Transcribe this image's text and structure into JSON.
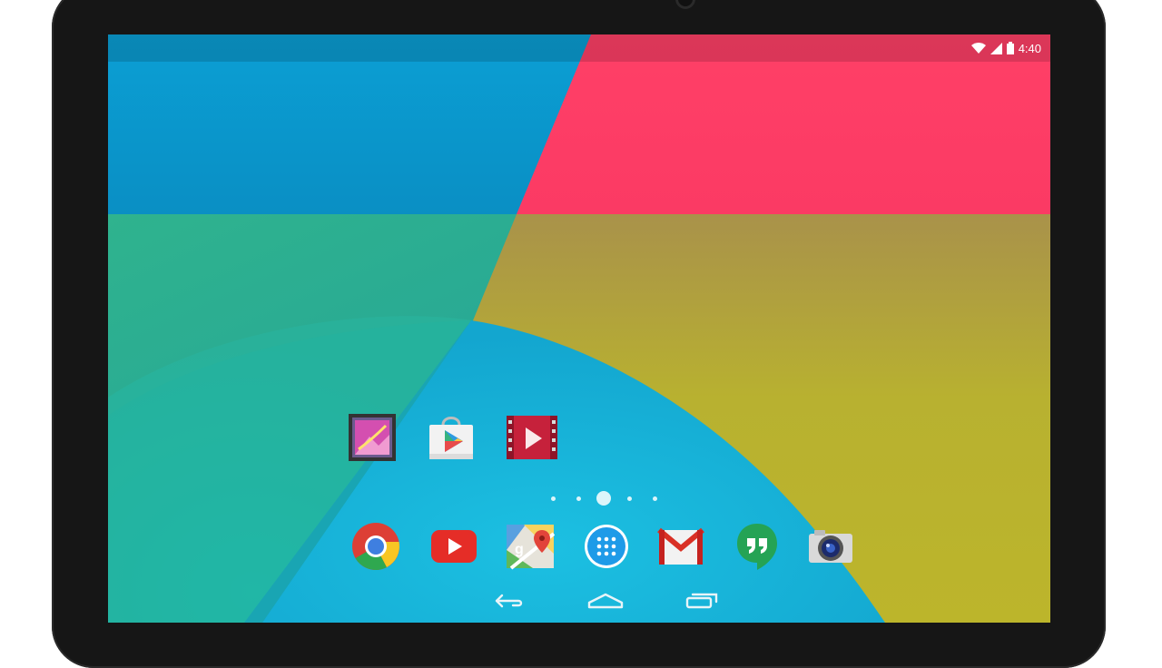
{
  "status_bar": {
    "time": "4:40",
    "icons": [
      "wifi-icon",
      "signal-icon",
      "battery-icon"
    ]
  },
  "colors": {
    "wallpaper_blue": "#0a96cc",
    "wallpaper_pink": "#ff3c66",
    "wallpaper_teal": "#2eb08e",
    "wallpaper_olive": "#b8b52e",
    "wallpaper_cyan": "#18b6d8",
    "bezel": "#161616"
  },
  "home_screen": {
    "apps": [
      "gallery-icon",
      "play-store-icon",
      "play-movies-icon"
    ],
    "page_indicator": {
      "pages": 5,
      "current_page": 3
    }
  },
  "dock": {
    "apps": [
      "chrome-icon",
      "youtube-icon",
      "maps-icon",
      "app-drawer-icon",
      "gmail-icon",
      "hangouts-icon",
      "camera-app-icon"
    ]
  },
  "navigation_bar": {
    "buttons": [
      "back-icon",
      "home-icon",
      "recents-icon"
    ]
  }
}
